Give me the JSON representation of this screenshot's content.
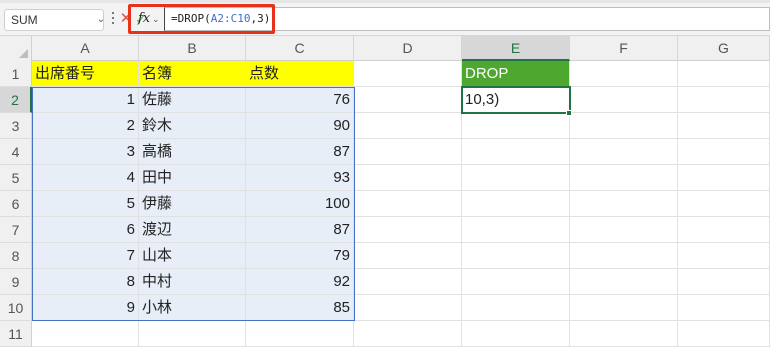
{
  "name_box": {
    "value": "SUM"
  },
  "formula_bar": {
    "fx_label": "fx",
    "formula_prefix": "=DROP(",
    "formula_range": "A2:C10",
    "formula_suffix": ",3)"
  },
  "columns": [
    "A",
    "B",
    "C",
    "D",
    "E",
    "F",
    "G"
  ],
  "rows": [
    "1",
    "2",
    "3",
    "4",
    "5",
    "6",
    "7",
    "8",
    "9",
    "10",
    "11"
  ],
  "sheet": {
    "header": {
      "a": "出席番号",
      "b": "名簿",
      "c": "点数",
      "e": "DROP"
    },
    "e2_value": "10,3)",
    "records": [
      {
        "no": "1",
        "name": "佐藤",
        "score": "76"
      },
      {
        "no": "2",
        "name": "鈴木",
        "score": "90"
      },
      {
        "no": "3",
        "name": "高橋",
        "score": "87"
      },
      {
        "no": "4",
        "name": "田中",
        "score": "93"
      },
      {
        "no": "5",
        "name": "伊藤",
        "score": "100"
      },
      {
        "no": "6",
        "name": "渡辺",
        "score": "87"
      },
      {
        "no": "7",
        "name": "山本",
        "score": "79"
      },
      {
        "no": "8",
        "name": "中村",
        "score": "92"
      },
      {
        "no": "9",
        "name": "小林",
        "score": "85"
      }
    ]
  },
  "colors": {
    "header_yellow": "#ffff00",
    "header_green": "#4ea72e",
    "highlight_red": "#e8311a",
    "range_blue": "#4472c4",
    "active_green": "#217346"
  }
}
